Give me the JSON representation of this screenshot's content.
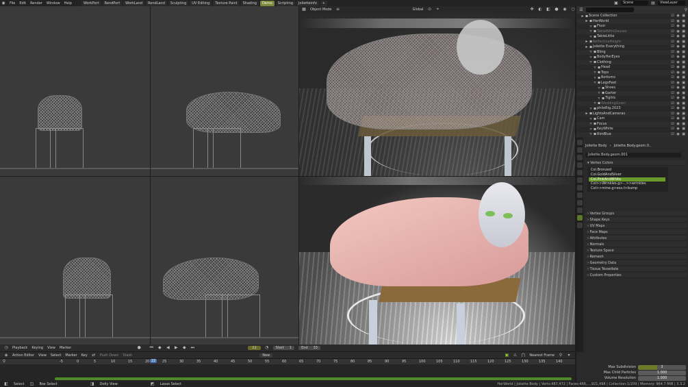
{
  "topbar": {
    "menus": [
      "File",
      "Edit",
      "Render",
      "Window",
      "Help"
    ],
    "workspaces": [
      "WorkPort",
      "RendPort",
      "WorkLand",
      "RendLand",
      "Sculpting",
      "UV Editing",
      "Texture Paint",
      "Shading",
      "Demo",
      "Scripting",
      "Jolietteinfo"
    ],
    "active_workspace": "Demo",
    "add_tab": "+",
    "scene": "Scene",
    "view_layer": "ViewLayer"
  },
  "viewport": {
    "mode": "Object Mode",
    "orientation": "Global"
  },
  "outliner": {
    "rows": [
      {
        "label": "Scene Collection",
        "indent": 0,
        "dim": false
      },
      {
        "label": "HerWorld",
        "indent": 1,
        "dim": false
      },
      {
        "label": "Floor",
        "indent": 2,
        "dim": false
      },
      {
        "label": "TableWithGlasses",
        "indent": 2,
        "dim": true
      },
      {
        "label": "TableLittle",
        "indent": 2,
        "dim": false
      },
      {
        "label": "ReflectiveHeight",
        "indent": 1,
        "dim": true
      },
      {
        "label": "Joliette Everything",
        "indent": 1,
        "dim": false
      },
      {
        "label": "Bling",
        "indent": 2,
        "dim": false
      },
      {
        "label": "BodyHerEyes",
        "indent": 2,
        "dim": false
      },
      {
        "label": "Clothing",
        "indent": 2,
        "dim": false
      },
      {
        "label": "Head",
        "indent": 3,
        "dim": false
      },
      {
        "label": "Tops",
        "indent": 3,
        "dim": false
      },
      {
        "label": "Bottoms",
        "indent": 3,
        "dim": false
      },
      {
        "label": "LegsFeet",
        "indent": 3,
        "dim": false
      },
      {
        "label": "Shoes",
        "indent": 4,
        "dim": false
      },
      {
        "label": "Garter",
        "indent": 4,
        "dim": false
      },
      {
        "label": "Tights",
        "indent": 4,
        "dim": false
      },
      {
        "label": "WeddingGown",
        "indent": 3,
        "dim": true
      },
      {
        "label": "philoRig.2023",
        "indent": 2,
        "dim": false
      },
      {
        "label": "LightsAndCameras",
        "indent": 1,
        "dim": false
      },
      {
        "label": "Cam",
        "indent": 2,
        "dim": false
      },
      {
        "label": "Focus",
        "indent": 2,
        "dim": false
      },
      {
        "label": "KeyWhite",
        "indent": 2,
        "dim": false
      },
      {
        "label": "RimBlue",
        "indent": 2,
        "dim": false
      }
    ]
  },
  "properties": {
    "object": "Joliette Body",
    "mesh": "Joliette.Body.geom.0..",
    "mesh_data": "Joliette.Body.geom.001",
    "vertex_colors_title": "Vertex Colors",
    "vertex_colors": [
      "Col.Bronzed",
      "Col.GoldAndSilver",
      "Col.PinkAndWhite",
      "Col>>Wrinkles.g>-..>>wrinkles",
      "Col>>mine.g>ess.t>bump"
    ],
    "selected_index": 2,
    "panels": [
      "Vertex Groups",
      "Shape Keys",
      "UV Maps",
      "Face Maps",
      "Attributes",
      "Normals",
      "Texture Space",
      "Remesh",
      "Geometry Data",
      "Tissue Tessellate",
      "Custom Properties"
    ]
  },
  "timeline": {
    "menus": [
      "Playback",
      "Keying",
      "View",
      "Marker"
    ],
    "current_frame": "22",
    "start_label": "Start",
    "start": "1",
    "end_label": "End",
    "end": "33"
  },
  "action_editor": {
    "mode": "Action Editor",
    "menus": [
      "View",
      "Select",
      "Marker",
      "Key"
    ],
    "push_down": "Push Down",
    "stash": "Stash",
    "new_label": "New",
    "snap": "Nearest Frame",
    "ruler_ticks": [
      "-5",
      "0",
      "5",
      "10",
      "15",
      "20",
      "25",
      "30",
      "35",
      "40",
      "45",
      "50",
      "55",
      "60",
      "65",
      "70",
      "75",
      "80",
      "85",
      "90",
      "95",
      "100",
      "105",
      "110",
      "115",
      "120",
      "125",
      "130",
      "135",
      "140"
    ],
    "current": "22"
  },
  "hair": {
    "rows": [
      {
        "label": "Max Subdivision",
        "value": "3"
      },
      {
        "label": "Max Child Particles",
        "value": "1.000"
      },
      {
        "label": "Volume Resolution",
        "value": "1.000"
      }
    ]
  },
  "status": {
    "items": [
      "Select",
      "Box Select",
      "Dolly View",
      "Lasso Select"
    ],
    "stats": "HerWorld | Joliette Body | Verts:487,472 | Faces:466,...,921,498 | Collection:1/209 | Memory: 964.7 MiB | 3.3.2"
  }
}
